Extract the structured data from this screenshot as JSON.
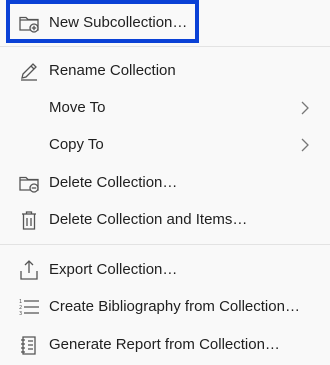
{
  "menu": {
    "items": [
      {
        "label": "New Subcollection…",
        "icon": "folder-add-icon"
      },
      {
        "label": "Rename Collection",
        "icon": "pencil-icon"
      },
      {
        "label": "Move To",
        "icon": null,
        "submenu": true
      },
      {
        "label": "Copy To",
        "icon": null,
        "submenu": true
      },
      {
        "label": "Delete Collection…",
        "icon": "folder-minus-icon"
      },
      {
        "label": "Delete Collection and Items…",
        "icon": "trash-icon"
      },
      {
        "label": "Export Collection…",
        "icon": "export-icon"
      },
      {
        "label": "Create Bibliography from Collection…",
        "icon": "bibliography-list-icon"
      },
      {
        "label": "Generate Report from Collection…",
        "icon": "report-icon"
      }
    ]
  },
  "colors": {
    "focus_outline": "#0a41d6",
    "background": "#f9f9f9",
    "text": "#1f1f1f",
    "icon_stroke": "#555555"
  }
}
